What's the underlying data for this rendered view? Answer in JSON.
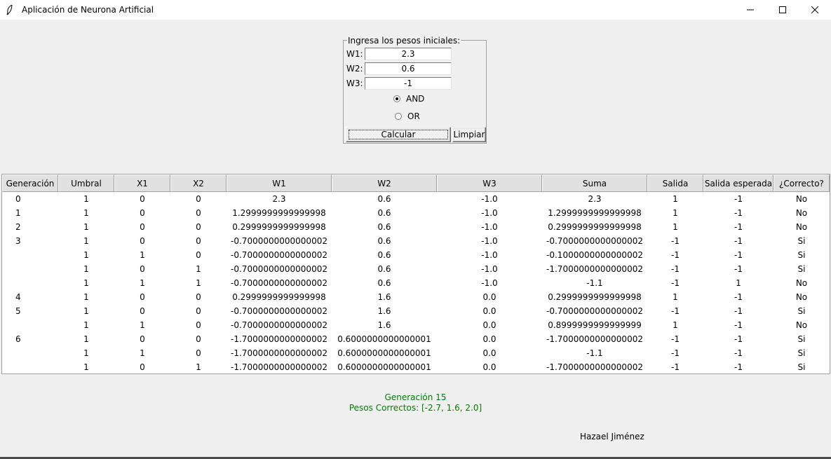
{
  "window": {
    "title": "Aplicación de Neurona Artificial",
    "controls": [
      "minimize-icon",
      "maximize-icon",
      "close-icon"
    ]
  },
  "weights_frame": {
    "legend": "Ingresa los pesos iniciales:",
    "w1_label": "W1:",
    "w1_value": "2.3",
    "w2_label": "W2:",
    "w2_value": "0.6",
    "w3_label": "W3:",
    "w3_value": "-1",
    "radio_and": "AND",
    "radio_or": "OR",
    "selected": "AND",
    "calcular_label": "Calcular",
    "limpiar_label": "Limpiar"
  },
  "table": {
    "columns": [
      "Generación",
      "Umbral",
      "X1",
      "X2",
      "W1",
      "W2",
      "W3",
      "Suma",
      "Salida",
      "Salida esperada",
      "¿Correcto?"
    ],
    "rows": [
      [
        "0",
        "1",
        "0",
        "0",
        "2.3",
        "0.6",
        "-1.0",
        "2.3",
        "1",
        "-1",
        "No"
      ],
      [
        "1",
        "1",
        "0",
        "0",
        "1.2999999999999998",
        "0.6",
        "-1.0",
        "1.2999999999999998",
        "1",
        "-1",
        "No"
      ],
      [
        "2",
        "1",
        "0",
        "0",
        "0.2999999999999998",
        "0.6",
        "-1.0",
        "0.2999999999999998",
        "1",
        "-1",
        "No"
      ],
      [
        "3",
        "1",
        "0",
        "0",
        "-0.7000000000000002",
        "0.6",
        "-1.0",
        "-0.7000000000000002",
        "-1",
        "-1",
        "Si"
      ],
      [
        "",
        "1",
        "1",
        "0",
        "-0.7000000000000002",
        "0.6",
        "-1.0",
        "-0.1000000000000002",
        "-1",
        "-1",
        "Si"
      ],
      [
        "",
        "1",
        "0",
        "1",
        "-0.7000000000000002",
        "0.6",
        "-1.0",
        "-1.7000000000000002",
        "-1",
        "-1",
        "Si"
      ],
      [
        "",
        "1",
        "1",
        "1",
        "-0.7000000000000002",
        "0.6",
        "-1.0",
        "-1.1",
        "-1",
        "1",
        "No"
      ],
      [
        "4",
        "1",
        "0",
        "0",
        "0.2999999999999998",
        "1.6",
        "0.0",
        "0.2999999999999998",
        "1",
        "-1",
        "No"
      ],
      [
        "5",
        "1",
        "0",
        "0",
        "-0.7000000000000002",
        "1.6",
        "0.0",
        "-0.7000000000000002",
        "-1",
        "-1",
        "Si"
      ],
      [
        "",
        "1",
        "1",
        "0",
        "-0.7000000000000002",
        "1.6",
        "0.0",
        "0.8999999999999999",
        "1",
        "-1",
        "No"
      ],
      [
        "6",
        "1",
        "0",
        "0",
        "-1.7000000000000002",
        "0.6000000000000001",
        "0.0",
        "-1.7000000000000002",
        "-1",
        "-1",
        "Si"
      ],
      [
        "",
        "1",
        "1",
        "0",
        "-1.7000000000000002",
        "0.6000000000000001",
        "0.0",
        "-1.1",
        "-1",
        "-1",
        "Si"
      ],
      [
        "",
        "1",
        "0",
        "1",
        "-1.7000000000000002",
        "0.6000000000000001",
        "0.0",
        "-1.7000000000000002",
        "-1",
        "-1",
        "Si"
      ]
    ]
  },
  "status": {
    "generation": "Generación 15",
    "correct_weights": "Pesos Correctos: [-2.7, 1.6, 2.0]",
    "color": "#008000"
  },
  "author": "Hazael Jiménez"
}
